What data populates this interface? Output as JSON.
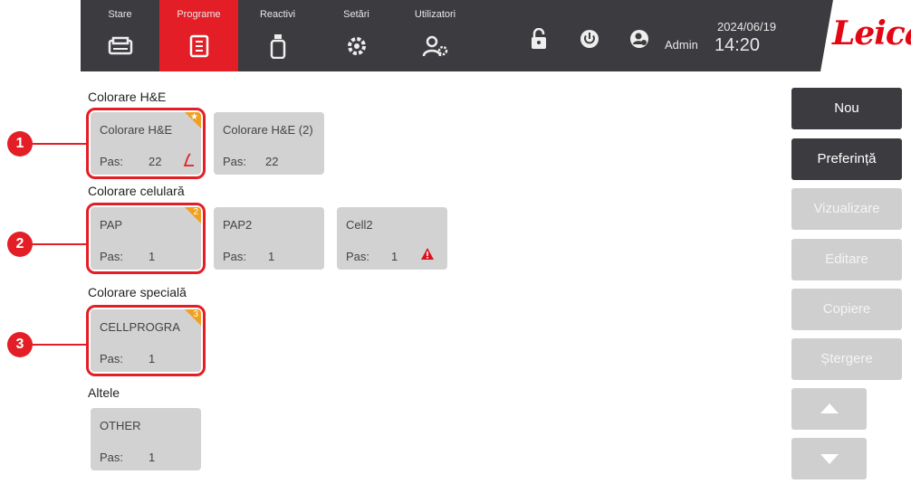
{
  "nav": {
    "tabs": [
      {
        "label": "Stare",
        "icon": "printer-icon"
      },
      {
        "label": "Programe",
        "icon": "program-list-icon"
      },
      {
        "label": "Reactivi",
        "icon": "reagent-bottle-icon"
      },
      {
        "label": "Setări",
        "icon": "settings-gear-icon"
      },
      {
        "label": "Utilizatori",
        "icon": "user-settings-icon"
      }
    ],
    "user": "Admin",
    "date": "2024/06/19",
    "time": "14:20",
    "logo": "Leica"
  },
  "sections": [
    {
      "title": "Colorare H&E",
      "cards": [
        {
          "name": "Colorare H&E",
          "pas_label": "Pas:",
          "pas": "22",
          "badge": "★",
          "icon": "leica-l-icon"
        },
        {
          "name": "Colorare H&E (2)",
          "pas_label": "Pas:",
          "pas": "22"
        }
      ]
    },
    {
      "title": "Colorare celulară",
      "cards": [
        {
          "name": "PAP",
          "pas_label": "Pas:",
          "pas": "1",
          "badge": "2"
        },
        {
          "name": "PAP2",
          "pas_label": "Pas:",
          "pas": "1"
        },
        {
          "name": "Cell2",
          "pas_label": "Pas:",
          "pas": "1",
          "icon": "warning-icon"
        }
      ]
    },
    {
      "title": "Colorare specială",
      "cards": [
        {
          "name": "CELLPROGRA",
          "pas_label": "Pas:",
          "pas": "1",
          "badge": "3"
        }
      ]
    },
    {
      "title": "Altele",
      "cards": [
        {
          "name": "OTHER",
          "pas_label": "Pas:",
          "pas": "1"
        }
      ]
    }
  ],
  "callouts": [
    "1",
    "2",
    "3"
  ],
  "actions": {
    "new": "Nou",
    "preference": "Preferință",
    "view": "Vizualizare",
    "edit": "Editare",
    "copy": "Copiere",
    "delete": "Ștergere"
  },
  "colors": {
    "accent": "#e31e26",
    "nav_bg": "#3c3c40",
    "card_bg": "#d2d2d2",
    "badge": "#f0a020",
    "disabled": "#cfcfcf"
  }
}
